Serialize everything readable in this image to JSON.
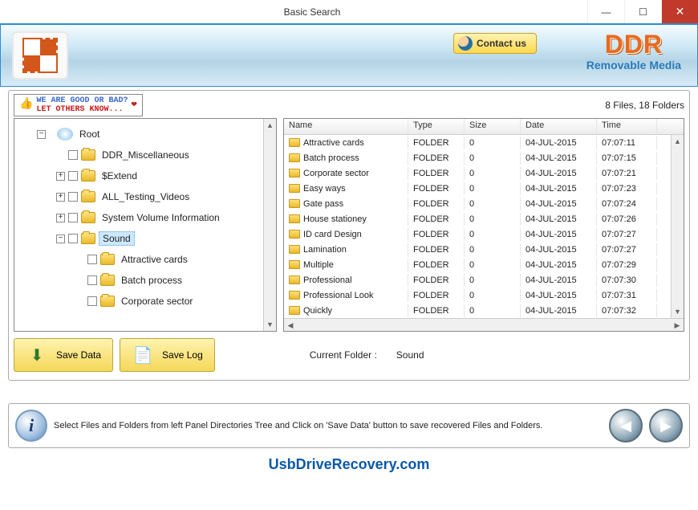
{
  "titlebar": {
    "title": "Basic Search"
  },
  "banner": {
    "contact_label": "Contact us",
    "brand": "DDR",
    "brand_sub": "Removable Media"
  },
  "promo": {
    "line1": "WE ARE GOOD OR BAD?",
    "line2": "LET OTHERS KNOW..."
  },
  "stats": "8 Files, 18 Folders",
  "tree": {
    "root": "Root",
    "items": [
      {
        "label": "DDR_Miscellaneous",
        "expander": "",
        "depth": 2
      },
      {
        "label": "$Extend",
        "expander": "+",
        "depth": 2
      },
      {
        "label": "ALL_Testing_Videos",
        "expander": "+",
        "depth": 2
      },
      {
        "label": "System Volume Information",
        "expander": "+",
        "depth": 2
      },
      {
        "label": "Sound",
        "expander": "−",
        "depth": 2,
        "selected": true
      },
      {
        "label": "Attractive cards",
        "expander": "",
        "depth": 3
      },
      {
        "label": "Batch process",
        "expander": "",
        "depth": 3
      },
      {
        "label": "Corporate sector",
        "expander": "",
        "depth": 3
      }
    ]
  },
  "list": {
    "headers": {
      "name": "Name",
      "type": "Type",
      "size": "Size",
      "date": "Date",
      "time": "Time"
    },
    "rows": [
      {
        "name": "Attractive cards",
        "type": "FOLDER",
        "size": "0",
        "date": "04-JUL-2015",
        "time": "07:07:11"
      },
      {
        "name": "Batch process",
        "type": "FOLDER",
        "size": "0",
        "date": "04-JUL-2015",
        "time": "07:07:15"
      },
      {
        "name": "Corporate sector",
        "type": "FOLDER",
        "size": "0",
        "date": "04-JUL-2015",
        "time": "07:07:21"
      },
      {
        "name": "Easy ways",
        "type": "FOLDER",
        "size": "0",
        "date": "04-JUL-2015",
        "time": "07:07:23"
      },
      {
        "name": "Gate pass",
        "type": "FOLDER",
        "size": "0",
        "date": "04-JUL-2015",
        "time": "07:07:24"
      },
      {
        "name": "House stationey",
        "type": "FOLDER",
        "size": "0",
        "date": "04-JUL-2015",
        "time": "07:07:26"
      },
      {
        "name": "ID card Design",
        "type": "FOLDER",
        "size": "0",
        "date": "04-JUL-2015",
        "time": "07:07:27"
      },
      {
        "name": "Lamination",
        "type": "FOLDER",
        "size": "0",
        "date": "04-JUL-2015",
        "time": "07:07:27"
      },
      {
        "name": "Multiple",
        "type": "FOLDER",
        "size": "0",
        "date": "04-JUL-2015",
        "time": "07:07:29"
      },
      {
        "name": "Professional",
        "type": "FOLDER",
        "size": "0",
        "date": "04-JUL-2015",
        "time": "07:07:30"
      },
      {
        "name": "Professional Look",
        "type": "FOLDER",
        "size": "0",
        "date": "04-JUL-2015",
        "time": "07:07:31"
      },
      {
        "name": "Quickly",
        "type": "FOLDER",
        "size": "0",
        "date": "04-JUL-2015",
        "time": "07:07:32"
      }
    ]
  },
  "actions": {
    "save_data": "Save Data",
    "save_log": "Save Log"
  },
  "current_folder": {
    "label": "Current Folder :",
    "value": "Sound"
  },
  "footer": {
    "text": "Select Files and Folders from left Panel Directories Tree and Click on 'Save Data' button to save recovered Files and Folders."
  },
  "brand_link": "UsbDriveRecovery.com"
}
